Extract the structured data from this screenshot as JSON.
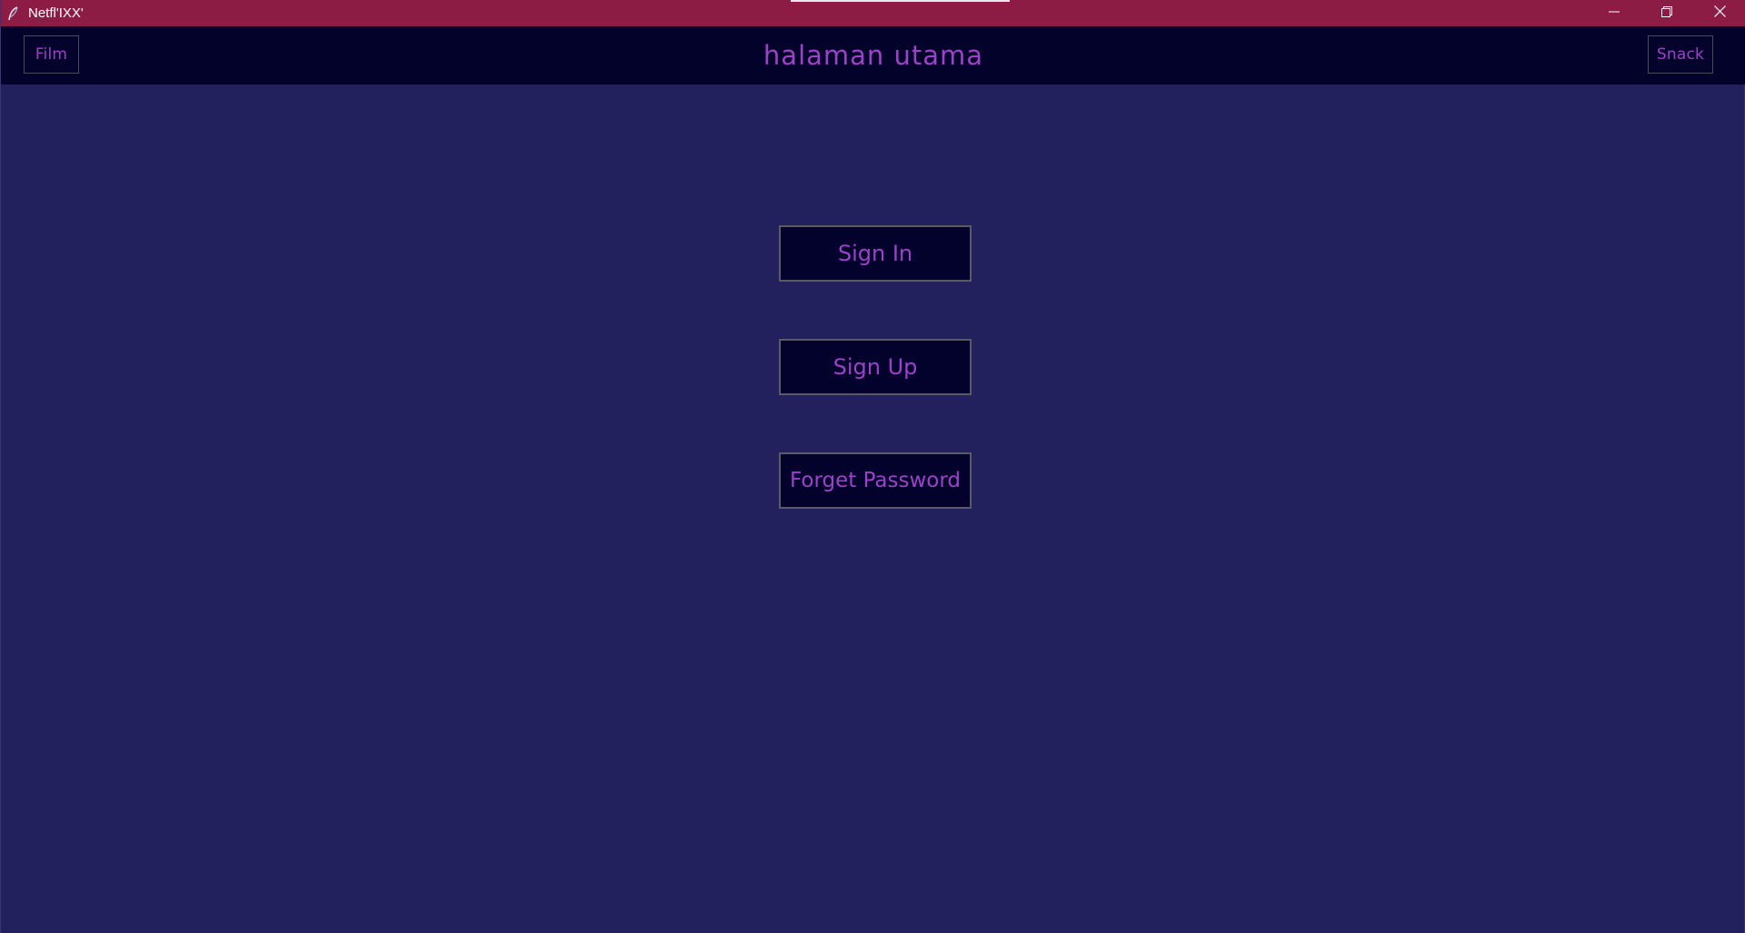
{
  "window": {
    "title": "Netfl'IXX'"
  },
  "header": {
    "title": "halaman utama",
    "film_label": "Film",
    "snack_label": "Snack"
  },
  "actions": {
    "sign_in": "Sign In",
    "sign_up": "Sign Up",
    "forget_password": "Forget Password"
  },
  "icons": {
    "app": "feather-icon",
    "minimize": "minimize-icon",
    "restore": "restore-icon",
    "close": "close-icon"
  },
  "colors": {
    "titlebar": "#8c1c44",
    "header": "#03022a",
    "background": "#23215d",
    "accent_text": "#9b43c7",
    "button_bg": "#03022c"
  }
}
